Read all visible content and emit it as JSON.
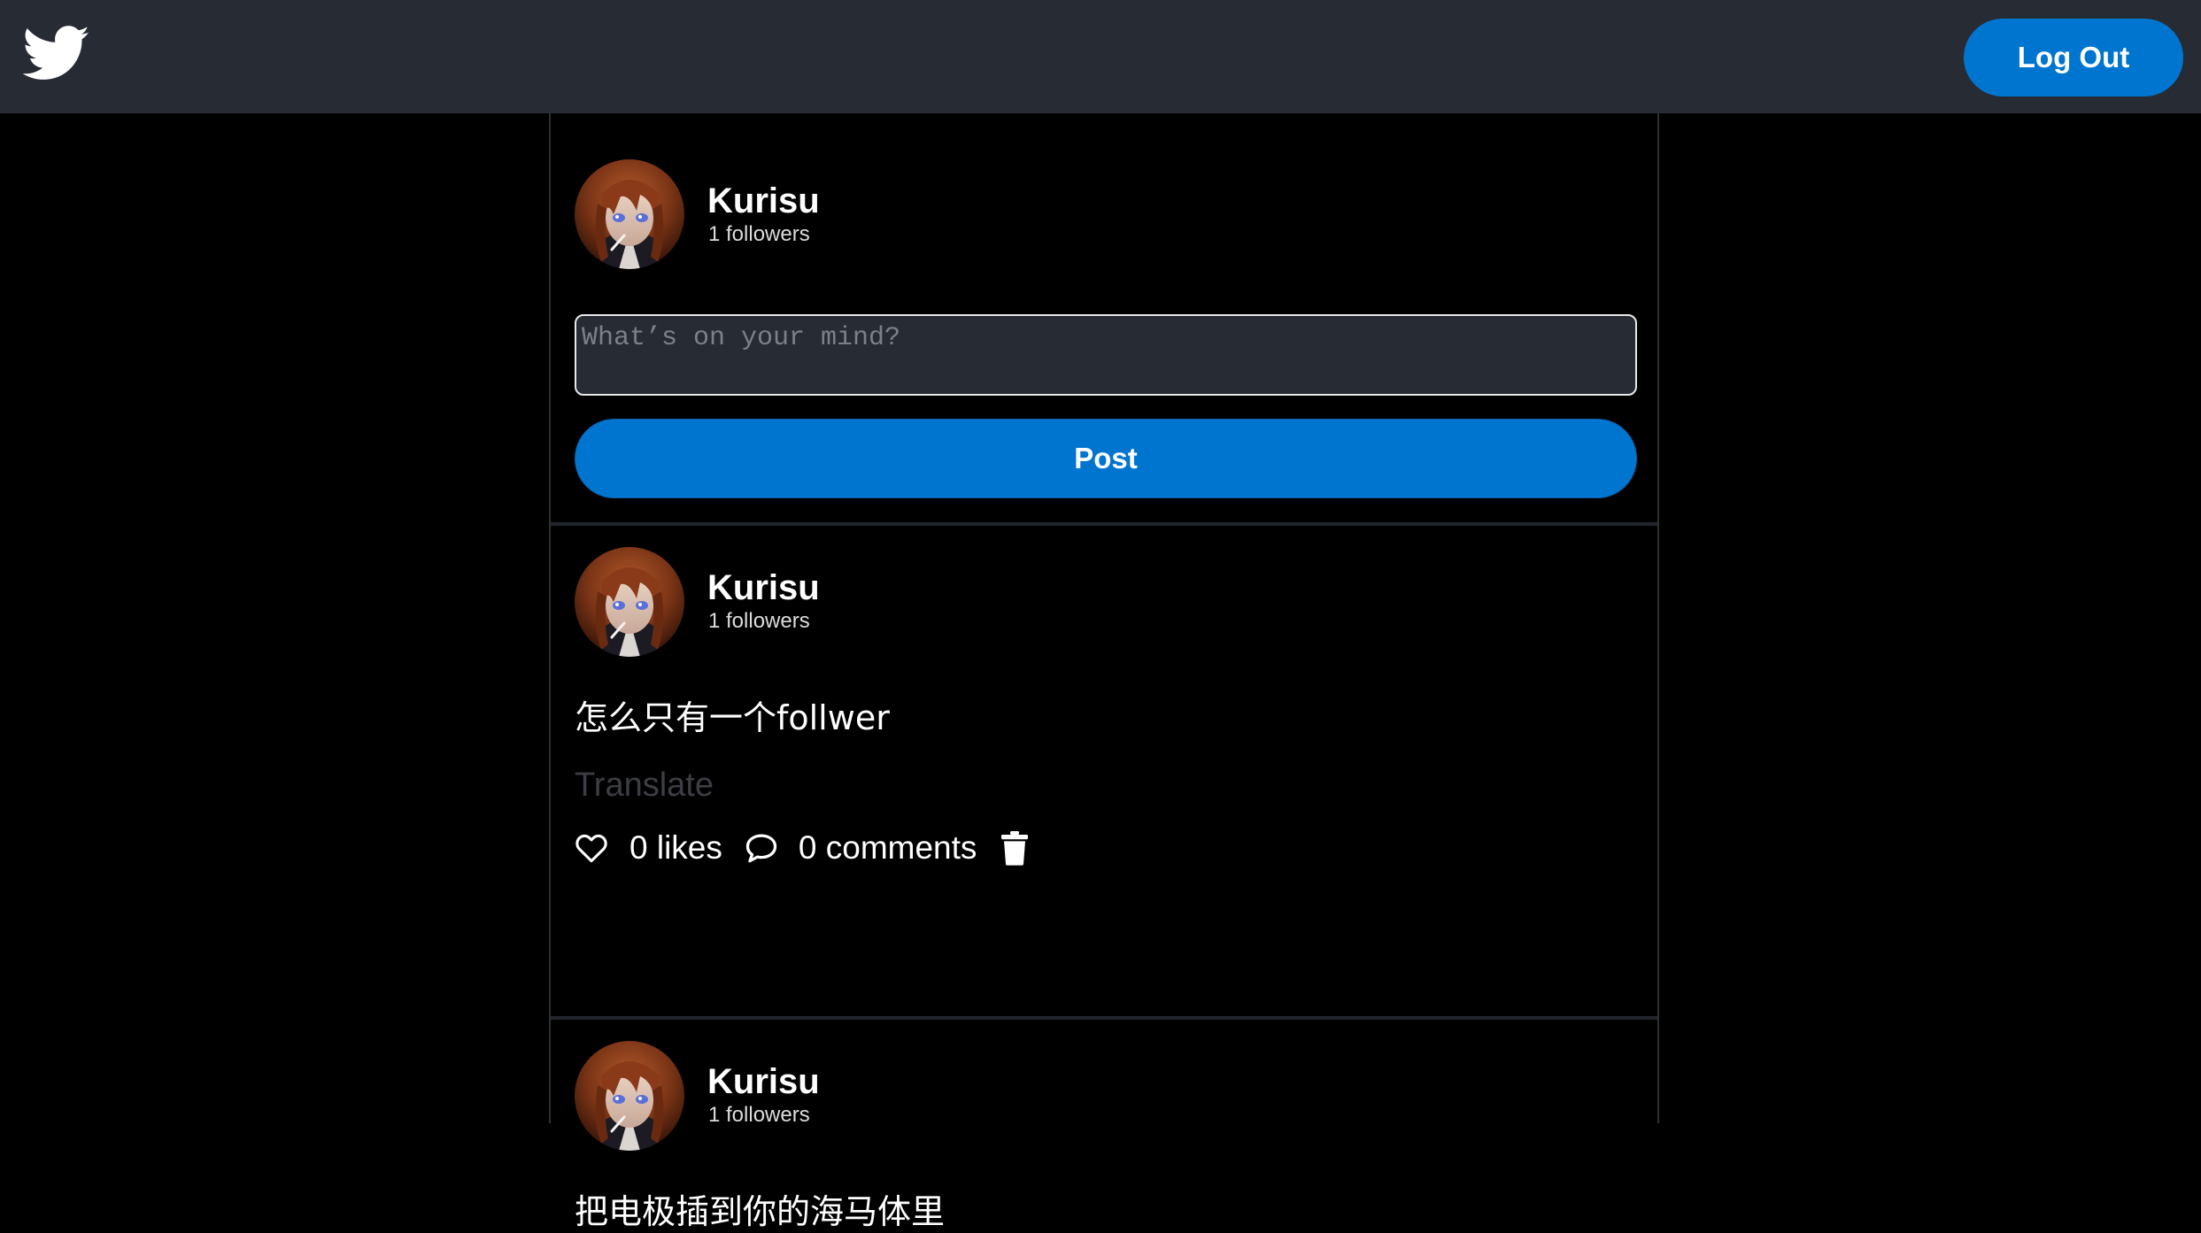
{
  "header": {
    "logo_icon": "twitter-bird-icon",
    "logout_label": "Log Out"
  },
  "colors": {
    "topbar": "#272b34",
    "accent": "#0075d0",
    "background": "#000000"
  },
  "composer": {
    "user": {
      "name": "Kurisu",
      "followers": "1 followers"
    },
    "placeholder": "What’s on your mind?",
    "post_label": "Post"
  },
  "feed": [
    {
      "user": {
        "name": "Kurisu",
        "followers": "1 followers"
      },
      "text": "怎么只有一个follwer",
      "translate_label": "Translate",
      "likes": "0 likes",
      "comments": "0 comments",
      "icons": [
        "heart-icon",
        "comment-icon",
        "trash-icon"
      ]
    },
    {
      "user": {
        "name": "Kurisu",
        "followers": "1 followers"
      },
      "text": "把电极插到你的海马体里"
    }
  ]
}
